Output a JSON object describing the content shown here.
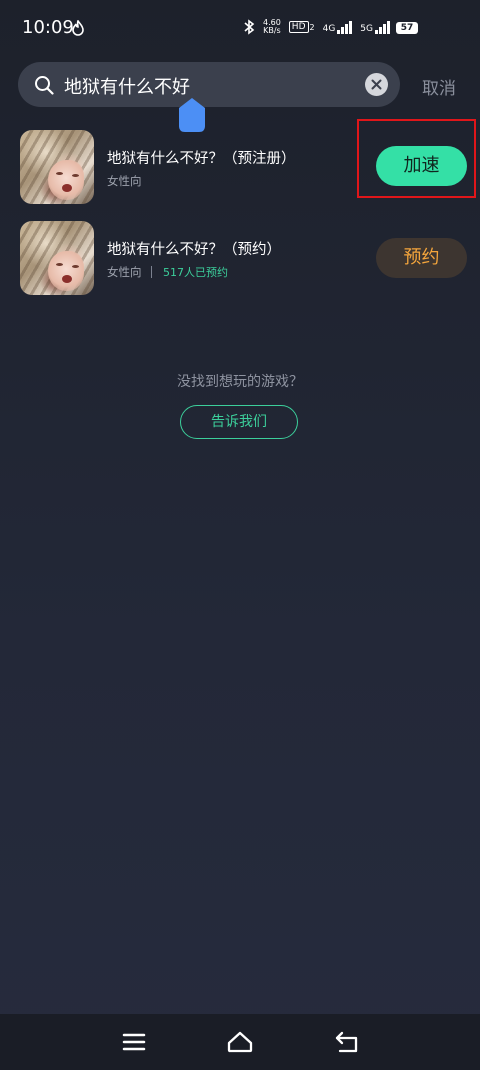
{
  "status_bar": {
    "time": "10:09",
    "net_speed_value": "4.60",
    "net_speed_unit": "KB/s",
    "hd_label": "HD",
    "hd_sub": "2",
    "signal_1_label": "4G",
    "signal_2_label": "5G",
    "battery": "57"
  },
  "search": {
    "query": "地狱有什么不好",
    "cancel_label": "取消"
  },
  "results": [
    {
      "title": "地狱有什么不好？（预注册）",
      "tag": "女性向",
      "action_label": "加速"
    },
    {
      "title": "地狱有什么不好？（预约）",
      "tag": "女性向",
      "reserve_count": "517人已预约",
      "action_label": "预约"
    }
  ],
  "empty_prompt": {
    "text": "没找到想玩的游戏？",
    "button_label": "告诉我们"
  },
  "colors": {
    "accent_green": "#34e0a6",
    "reserve_orange": "#f4a53c",
    "highlight_red": "#e0161a"
  }
}
